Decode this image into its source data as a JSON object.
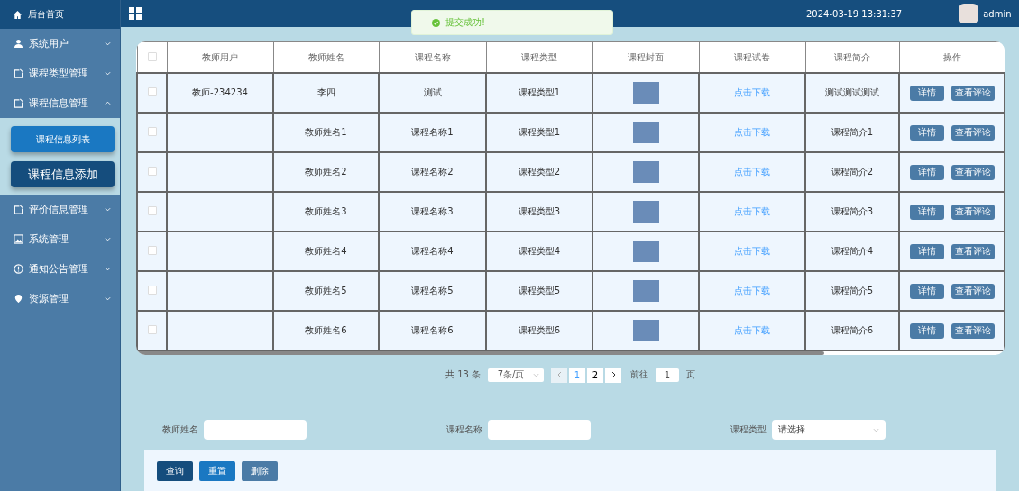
{
  "sidebar": {
    "home": "后台首页",
    "items": [
      {
        "label": "系统用户",
        "expanded": false
      },
      {
        "label": "课程类型管理",
        "expanded": false
      },
      {
        "label": "课程信息管理",
        "expanded": true,
        "children": [
          {
            "label": "课程信息列表",
            "selected": false
          },
          {
            "label": "课程信息添加",
            "selected": true
          }
        ]
      },
      {
        "label": "评价信息管理",
        "expanded": false
      },
      {
        "label": "系统管理",
        "expanded": false
      },
      {
        "label": "通知公告管理",
        "expanded": false
      },
      {
        "label": "资源管理",
        "expanded": false
      }
    ]
  },
  "header": {
    "datetime": "2024-03-19 13:31:37",
    "user": "admin"
  },
  "toast": {
    "message": "提交成功!"
  },
  "table": {
    "select_all_checked": false,
    "columns": [
      "教师用户",
      "教师姓名",
      "课程名称",
      "课程类型",
      "课程封面",
      "课程试卷",
      "课程简介",
      "操作"
    ],
    "rows": [
      {
        "checked": false,
        "user": "教师-234234",
        "name": "李四",
        "course": "测试",
        "type": "课程类型1",
        "paper": "点击下载",
        "intro": "测试测试测试",
        "actions": [
          "详情",
          "查看评论"
        ]
      },
      {
        "checked": false,
        "name": "教师姓名1",
        "course": "课程名称1",
        "type": "课程类型1",
        "paper": "点击下载",
        "intro": "课程简介1",
        "actions": [
          "详情",
          "查看评论"
        ]
      },
      {
        "checked": false,
        "name": "教师姓名2",
        "course": "课程名称2",
        "type": "课程类型2",
        "paper": "点击下载",
        "intro": "课程简介2",
        "actions": [
          "详情",
          "查看评论"
        ]
      },
      {
        "checked": false,
        "name": "教师姓名3",
        "course": "课程名称3",
        "type": "课程类型3",
        "paper": "点击下载",
        "intro": "课程简介3",
        "actions": [
          "详情",
          "查看评论"
        ]
      },
      {
        "checked": false,
        "name": "教师姓名4",
        "course": "课程名称4",
        "type": "课程类型4",
        "paper": "点击下载",
        "intro": "课程简介4",
        "actions": [
          "详情",
          "查看评论"
        ]
      },
      {
        "checked": false,
        "name": "教师姓名5",
        "course": "课程名称5",
        "type": "课程类型5",
        "paper": "点击下载",
        "intro": "课程简介5",
        "actions": [
          "详情",
          "查看评论"
        ]
      },
      {
        "checked": false,
        "name": "教师姓名6",
        "course": "课程名称6",
        "type": "课程类型6",
        "paper": "点击下载",
        "intro": "课程简介6",
        "actions": [
          "详情",
          "查看评论"
        ]
      }
    ]
  },
  "pagination": {
    "total": "共 13 条",
    "page_size": "7条/页",
    "pages": [
      {
        "label": "1",
        "selected": true
      },
      {
        "label": "2",
        "selected": false
      }
    ],
    "goto_label": "前往",
    "goto_value": "1",
    "page_unit": "页"
  },
  "search": {
    "fields": [
      {
        "label": "教师姓名",
        "kind": "input"
      },
      {
        "label": "课程名称",
        "kind": "input"
      },
      {
        "label": "课程类型",
        "kind": "select",
        "placeholder": "请选择"
      }
    ],
    "buttons": [
      {
        "label": "查询",
        "kind": "primary"
      },
      {
        "label": "重置",
        "kind": "info"
      },
      {
        "label": "删除",
        "kind": "muted"
      }
    ]
  }
}
